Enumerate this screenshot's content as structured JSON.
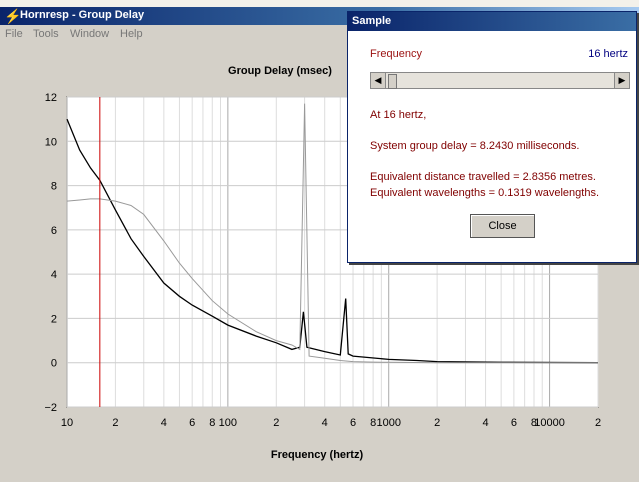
{
  "window": {
    "title": "Hornresp - Group Delay",
    "icon": "lightning-icon"
  },
  "menu": [
    "File",
    "Tools",
    "Window",
    "Help"
  ],
  "chart": {
    "title": "Group Delay (msec)",
    "xlabel": "Frequency (hertz)",
    "yticks": [
      "12",
      "10",
      "8",
      "6",
      "4",
      "2",
      "0",
      "−2"
    ],
    "xticks": [
      "10",
      "2",
      "4",
      "6",
      "8",
      "100",
      "2",
      "4",
      "6",
      "8",
      "1000",
      "2",
      "4",
      "6",
      "8",
      "10000",
      "2"
    ]
  },
  "chart_data": {
    "type": "line",
    "title": "Group Delay (msec)",
    "xlabel": "Frequency (hertz)",
    "ylabel": "",
    "xscale": "log",
    "xlim": [
      10,
      20000
    ],
    "ylim": [
      -2,
      12
    ],
    "series": [
      {
        "color": "#000000",
        "x": [
          10,
          12,
          14,
          16,
          20,
          25,
          30,
          40,
          50,
          60,
          80,
          100,
          150,
          200,
          250,
          280,
          295,
          310,
          400,
          500,
          540,
          560,
          600,
          1000,
          1500,
          2000,
          5000,
          20000
        ],
        "y": [
          11,
          9.6,
          8.8,
          8.243,
          6.9,
          5.6,
          4.8,
          3.6,
          3.0,
          2.6,
          2.1,
          1.7,
          1.2,
          0.9,
          0.6,
          0.7,
          2.3,
          0.7,
          0.5,
          0.35,
          2.9,
          0.4,
          0.3,
          0.15,
          0.1,
          0.05,
          0.02,
          0.0
        ]
      },
      {
        "color": "#999999",
        "x": [
          10,
          12,
          14,
          16,
          20,
          25,
          30,
          40,
          50,
          60,
          80,
          100,
          150,
          200,
          250,
          280,
          300,
          320,
          400,
          500,
          600,
          800,
          1000,
          2000,
          5000,
          20000
        ],
        "y": [
          7.3,
          7.35,
          7.4,
          7.4,
          7.3,
          7.1,
          6.7,
          5.5,
          4.5,
          3.8,
          2.8,
          2.2,
          1.4,
          1.0,
          0.8,
          0.6,
          11.7,
          0.3,
          0.2,
          0.1,
          0.05,
          0.03,
          0.02,
          0.0,
          0.0,
          0.0
        ]
      }
    ],
    "marker": {
      "x": 16,
      "color": "#cc0000"
    }
  },
  "dialog": {
    "title": "Sample",
    "frequency_label": "Frequency",
    "frequency_value": "16 hertz",
    "scroll_left": "◀",
    "scroll_right": "▶",
    "line1": "At 16 hertz,",
    "line2": "System group delay = 8.2430 milliseconds.",
    "line3": "Equivalent distance travelled = 2.8356 metres.",
    "line4": "Equivalent wavelengths = 0.1319 wavelengths.",
    "close_label": "Close"
  }
}
